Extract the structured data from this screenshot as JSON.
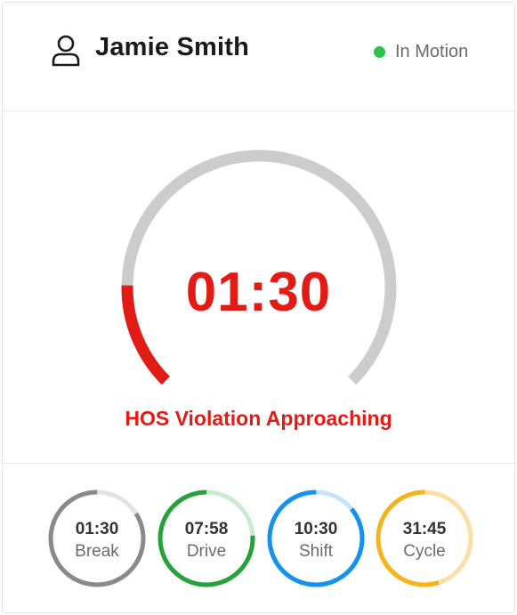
{
  "driver": {
    "name": "Jamie Smith",
    "status": "In Motion",
    "status_color": "#2ec24a"
  },
  "main_gauge": {
    "time": "01:30",
    "warning": "HOS Violation Approaching",
    "fraction_remaining": 0.17,
    "active_color": "#e21b14",
    "track_color": "#cccccc"
  },
  "timers": [
    {
      "id": "break",
      "value": "01:30",
      "label": "Break",
      "fraction": 0.84,
      "color": "#8a8a8a",
      "track": "#e2e2e2"
    },
    {
      "id": "drive",
      "value": "07:58",
      "label": "Drive",
      "fraction": 0.76,
      "color": "#27a23b",
      "track": "#c9ecce"
    },
    {
      "id": "shift",
      "value": "10:30",
      "label": "Shift",
      "fraction": 0.86,
      "color": "#1492f0",
      "track": "#c6e3fb"
    },
    {
      "id": "cycle",
      "value": "31:45",
      "label": "Cycle",
      "fraction": 0.55,
      "color": "#f6b31b",
      "track": "#fbe0a6"
    }
  ]
}
